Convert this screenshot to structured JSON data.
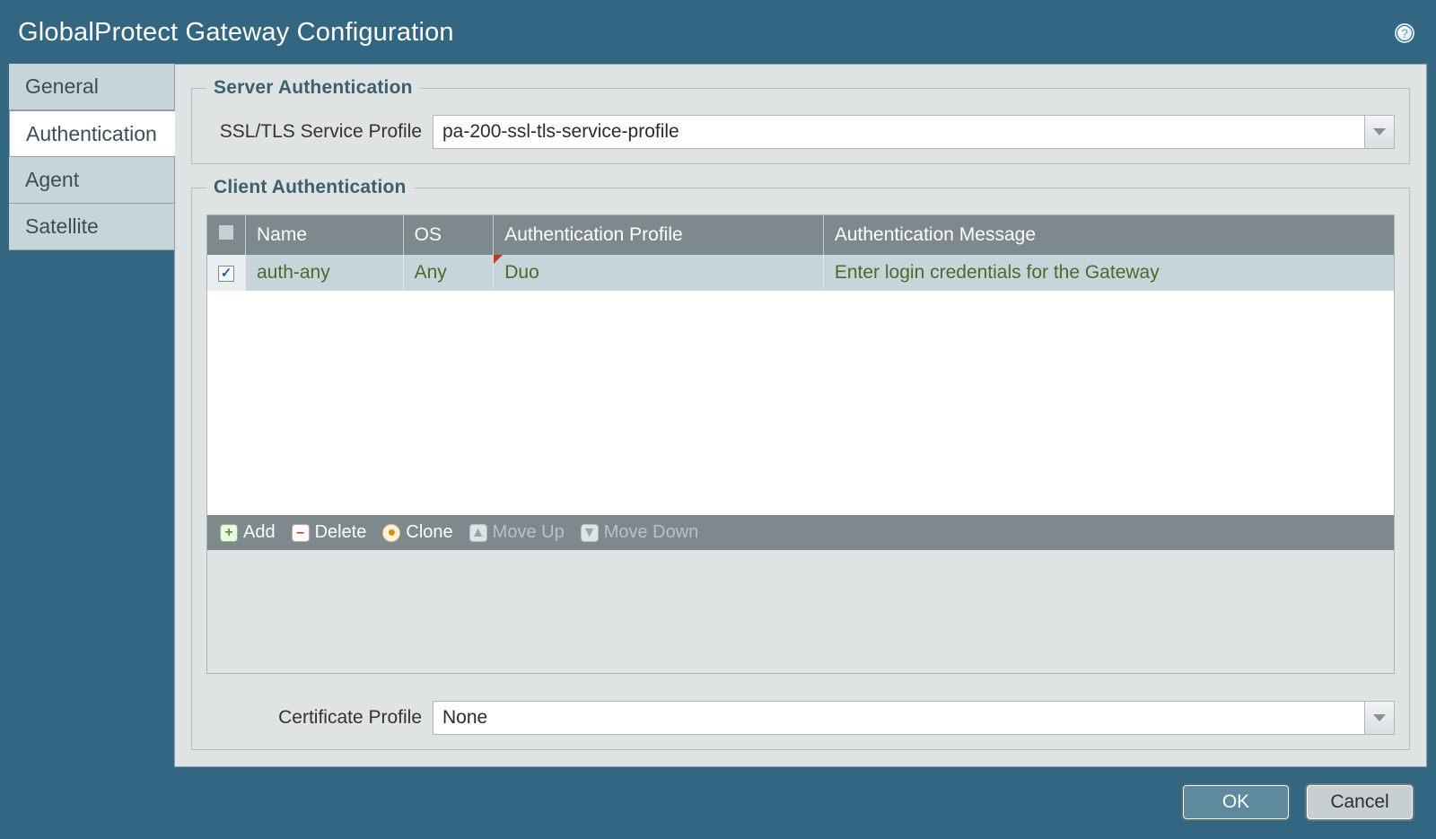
{
  "title": "GlobalProtect Gateway Configuration",
  "tabs": {
    "general": {
      "label": "General"
    },
    "authentication": {
      "label": "Authentication"
    },
    "agent": {
      "label": "Agent"
    },
    "satellite": {
      "label": "Satellite"
    }
  },
  "active_tab": "authentication",
  "server_auth": {
    "legend": "Server Authentication",
    "ssl_label": "SSL/TLS Service Profile",
    "ssl_value": "pa-200-ssl-tls-service-profile"
  },
  "client_auth": {
    "legend": "Client Authentication",
    "columns": {
      "name": "Name",
      "os": "OS",
      "auth_profile": "Authentication Profile",
      "auth_message": "Authentication Message"
    },
    "rows": [
      {
        "checked": true,
        "name": "auth-any",
        "os": "Any",
        "auth_profile": "Duo",
        "auth_message": "Enter login credentials for the Gateway"
      }
    ],
    "toolbar": {
      "add": "Add",
      "delete": "Delete",
      "clone": "Clone",
      "move_up": "Move Up",
      "move_down": "Move Down"
    }
  },
  "cert_profile": {
    "label": "Certificate Profile",
    "value": "None"
  },
  "buttons": {
    "ok": "OK",
    "cancel": "Cancel"
  }
}
